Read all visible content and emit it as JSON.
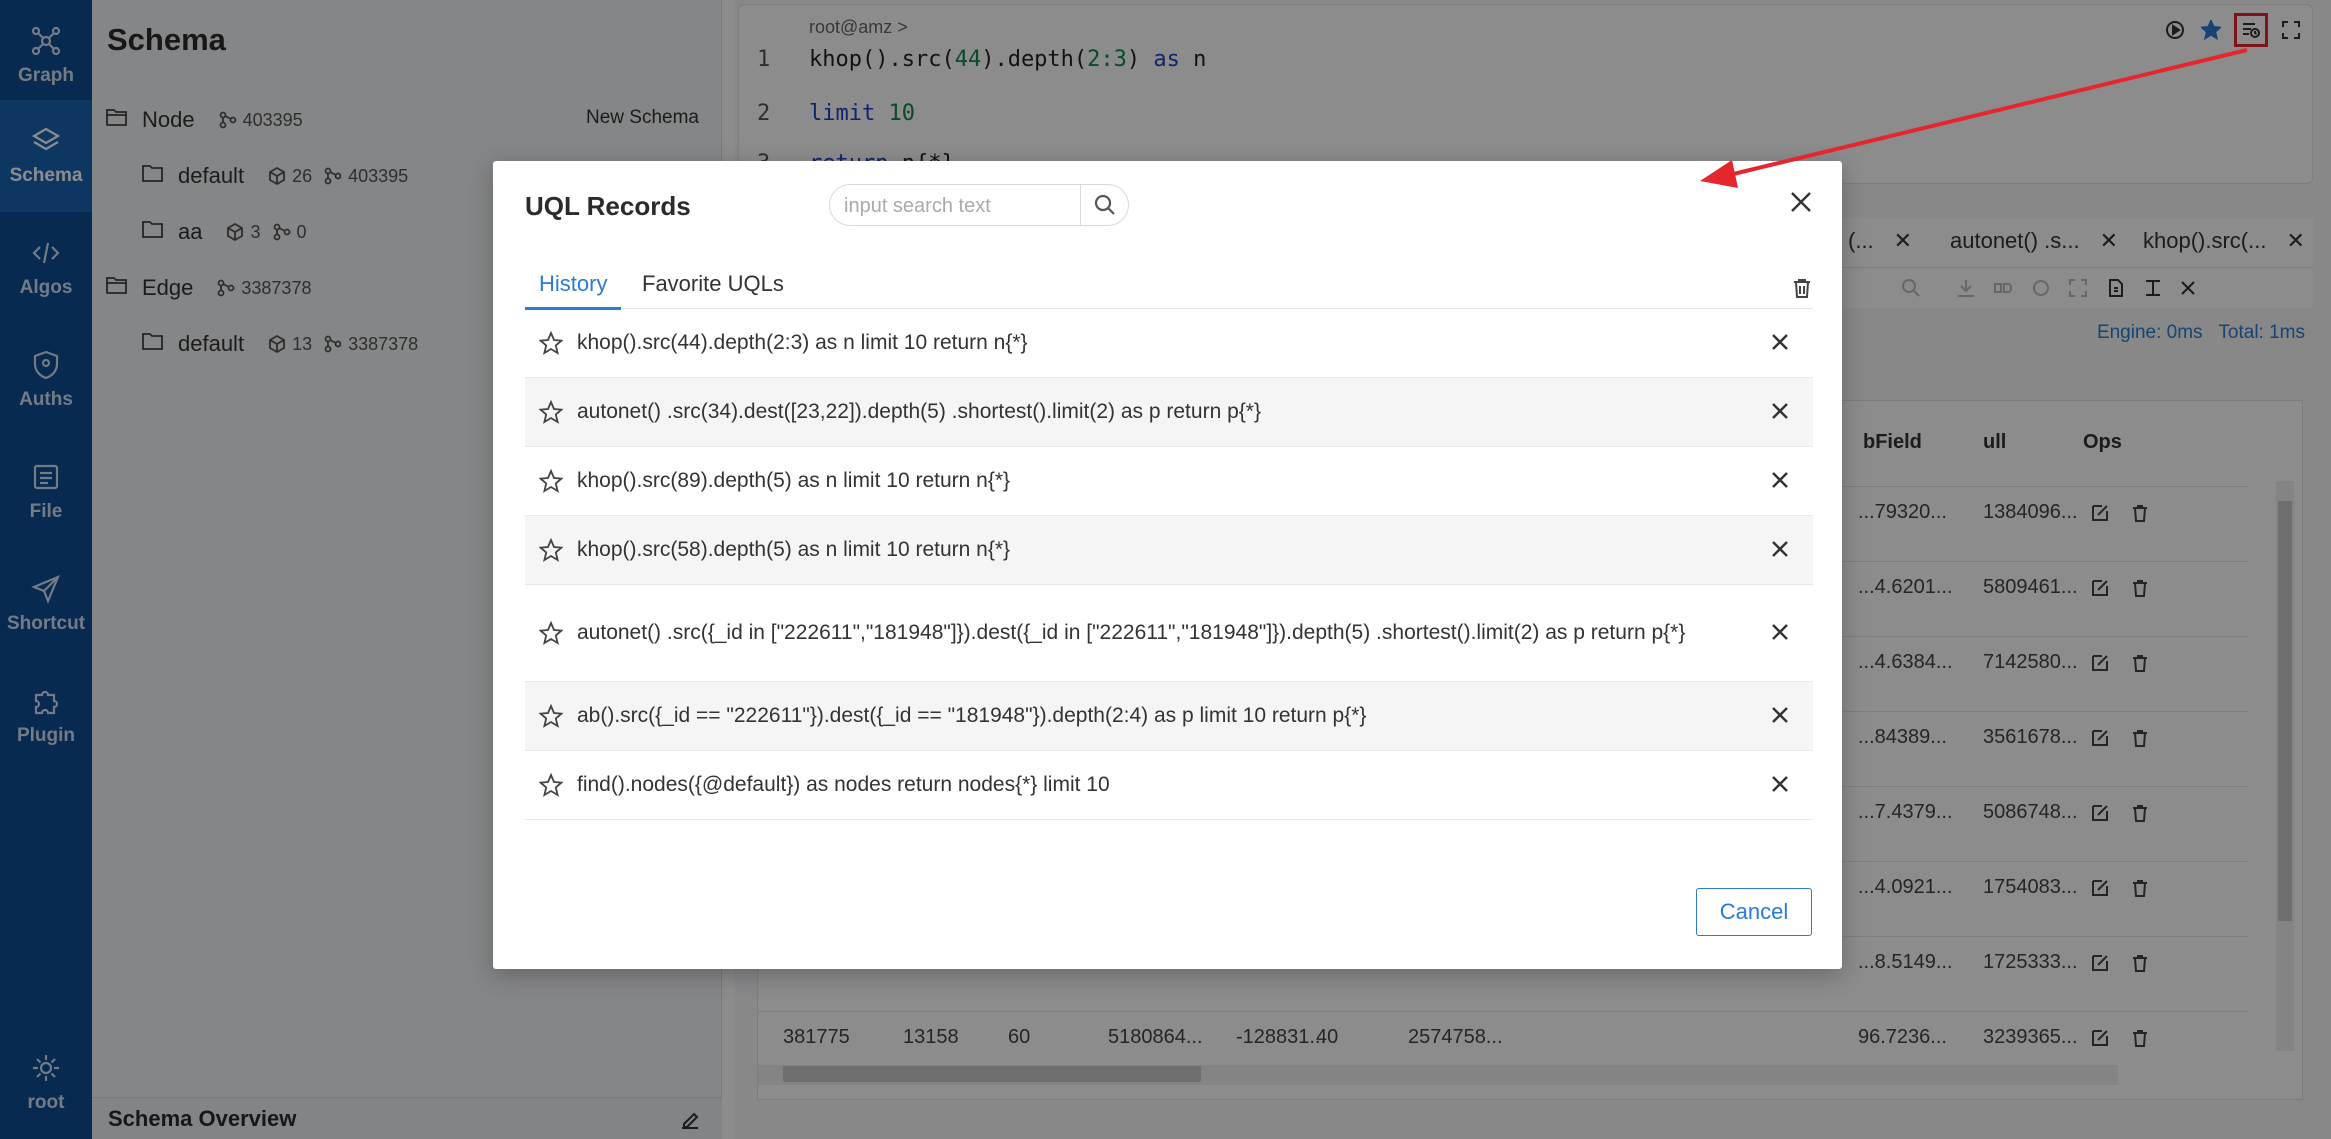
{
  "nav": {
    "items": [
      {
        "label": "Graph",
        "icon": "graph-icon"
      },
      {
        "label": "Schema",
        "icon": "layers-icon",
        "active": true
      },
      {
        "label": "Algos",
        "icon": "code-icon"
      },
      {
        "label": "Auths",
        "icon": "shield-icon"
      },
      {
        "label": "File",
        "icon": "file-icon"
      },
      {
        "label": "Shortcut",
        "icon": "send-icon"
      },
      {
        "label": "Plugin",
        "icon": "puzzle-icon"
      }
    ],
    "user": "root"
  },
  "schema": {
    "title": "Schema",
    "new_schema": "New Schema",
    "node": {
      "label": "Node",
      "count": "403395"
    },
    "node_items": [
      {
        "label": "default",
        "props": "26",
        "count": "403395"
      },
      {
        "label": "aa",
        "props": "3",
        "count": "0"
      }
    ],
    "edge": {
      "label": "Edge",
      "count": "3387378"
    },
    "edge_items": [
      {
        "label": "default",
        "props": "13",
        "count": "3387378"
      }
    ],
    "overview": "Schema Overview"
  },
  "editor": {
    "prompt": "root@amz >",
    "lines": [
      {
        "n": "1",
        "parts": [
          [
            "khop().src(",
            ""
          ],
          [
            "44",
            "num"
          ],
          [
            ").depth(",
            ""
          ],
          [
            "2:3",
            "num"
          ],
          [
            ") ",
            ""
          ],
          [
            "as",
            "kw"
          ],
          [
            " n",
            ""
          ]
        ]
      },
      {
        "n": "2",
        "parts": [
          [
            "limit",
            "kw"
          ],
          [
            " ",
            ""
          ],
          [
            "10",
            "num"
          ]
        ]
      },
      {
        "n": "3",
        "parts": [
          [
            "return",
            "kw"
          ],
          [
            " n{*}",
            ""
          ]
        ]
      }
    ]
  },
  "result_tabs": [
    "(...",
    "autonet() .s...",
    "khop().src(..."
  ],
  "engine": "Engine: 0ms",
  "total": "Total: 1ms",
  "grid": {
    "headers": [
      "bField",
      "ull",
      "Ops"
    ],
    "rows": [
      [
        "",
        "",
        "",
        "",
        "",
        "",
        "",
        "...79320...",
        "1384096..."
      ],
      [
        "",
        "",
        "",
        "",
        "",
        "",
        "",
        "...4.6201...",
        "5809461..."
      ],
      [
        "",
        "",
        "",
        "",
        "",
        "",
        "",
        "...4.6384...",
        "7142580..."
      ],
      [
        "",
        "",
        "",
        "",
        "",
        "",
        "",
        "...84389...",
        "3561678..."
      ],
      [
        "",
        "",
        "",
        "",
        "",
        "",
        "",
        "...7.4379...",
        "5086748..."
      ],
      [
        "",
        "",
        "",
        "",
        "",
        "",
        "",
        "...4.0921...",
        "1754083..."
      ],
      [
        "",
        "",
        "",
        "",
        "",
        "",
        "",
        "...8.5149...",
        "1725333..."
      ],
      [
        "381775",
        "13158",
        "60",
        "5180864...",
        "-128831...",
        "40",
        "2574758...",
        "96.7236...",
        "3239365..."
      ]
    ]
  },
  "modal": {
    "title": "UQL Records",
    "search_placeholder": "input search text",
    "tabs": [
      "History",
      "Favorite UQLs"
    ],
    "active_tab": "History",
    "records": [
      "khop().src(44).depth(2:3) as n limit 10 return n{*}",
      "autonet() .src(34).dest([23,22]).depth(5) .shortest().limit(2) as p return p{*}",
      "khop().src(89).depth(5) as n limit 10 return n{*}",
      "khop().src(58).depth(5) as n limit 10 return n{*}",
      "autonet() .src({_id in [\"222611\",\"181948\"]}).dest({_id in [\"222611\",\"181948\"]}).depth(5) .shortest().limit(2) as p return p{*}",
      "ab().src({_id == \"222611\"}).dest({_id == \"181948\"}).depth(2:4) as p limit 10 return p{*}",
      "find().nodes({@default}) as nodes return nodes{*} limit 10"
    ],
    "cancel": "Cancel"
  },
  "colors": {
    "nav_bg": "#0f4b92",
    "accent": "#2b7bd6",
    "annotation": "#e5262c"
  }
}
